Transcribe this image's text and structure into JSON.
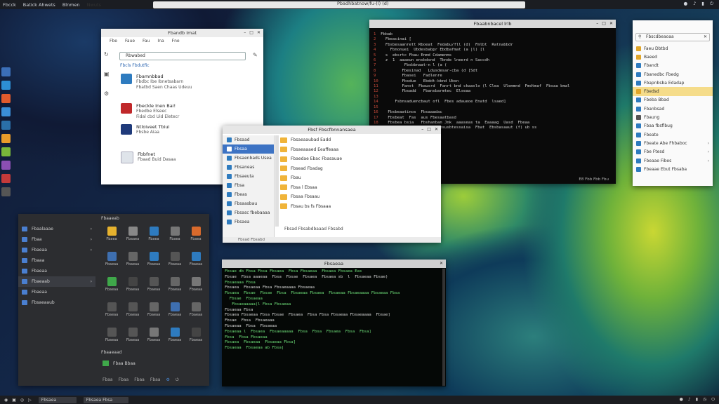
{
  "topbar": {
    "items": [
      "Fbcck",
      "Batick Ahwets",
      "Blnmen",
      "Nwuts"
    ],
    "center_title": "Pbadhbatnow/fu-(l) (d)",
    "right_icons": [
      "network-icon",
      "volume-icon",
      "battery-icon",
      "power-icon"
    ]
  },
  "software_window": {
    "title": "Fbandb Imat",
    "menu": [
      "Fbe",
      "Faue",
      "Fau",
      "Ina",
      "Fne"
    ],
    "search_value": "Rbwabed",
    "hint": "Fbcls Fbdutfic",
    "items": [
      {
        "title": "Fbamnbbad",
        "sub1": "Fbdbc Ibe Ibnetsabarn",
        "sub2": "Fbatbd Saen Chaas Udeuu",
        "color": "#2e7bbf"
      },
      {
        "title": "Fbeckle Inen Bai!",
        "sub1": "Fbedbe Elseec",
        "sub2": "Fidal cbd Uid Eletecr",
        "color": "#c0282a"
      },
      {
        "title": "Ntloiveet Tbiui",
        "sub1": "Fbsbe Aiaa",
        "sub2": "",
        "color": "#1f3a7a"
      },
      {
        "title": "Fbbfnet",
        "sub1": "Fbaad Buid Dasaa",
        "sub2": "",
        "color": "#dfe4ea"
      }
    ]
  },
  "code_window": {
    "title": "Fbaabnbacel lrlb",
    "lines": [
      {
        "n": "1",
        "t": "Fbbab"
      },
      {
        "n": "2",
        "t": "  Fbeacinai ["
      },
      {
        "n": "3",
        "t": "  Fbsbesaanrett Rboeat  Fedabu/fll (d)  Fmlbt  Ratnabbdr"
      },
      {
        "n": "4",
        "t": "    Fbnonuei  Ubdesbabpr Ebdbafmat (a |l) [l"
      },
      {
        "n": "5",
        "t": "  s  ebsrtc Fbau Enmd Cdamenms"
      },
      {
        "n": "6",
        "t": "  z  1  aaaeun ensbdsnd  Tbnde lneerd n Saccdh"
      },
      {
        "n": "7",
        "t": "          Fbsbbnaat-n l (a ("
      },
      {
        "n": "8",
        "t": "         Fbesinad   Ldusdesar-cba (d [Sdt"
      },
      {
        "n": "9",
        "t": "         Fbasei   Fadlenre"
      },
      {
        "n": "10",
        "t": "        Fbsdue   Ebddt-bbnd Ubsn"
      },
      {
        "n": "11",
        "t": "        Fanst  Fbausrd  Fanrt bnd ckaaslo (l Clea  Ulemmnd  Fmdtmaf  Fbsaa bmal"
      },
      {
        "n": "12",
        "t": "        Fbsadd   Fbansbarmtec  Elseaa"
      },
      {
        "n": "13",
        "t": ""
      },
      {
        "n": "14",
        "t": "     Fsbnsaduencbaut ofl  Fbes adaueoe Enatd  lsaed]"
      },
      {
        "n": "15",
        "t": ""
      },
      {
        "n": "16",
        "t": "  Fbsbeaatinos  Fbsaaadac"
      },
      {
        "n": "17",
        "t": "  Fbsbeat  Fas  aus Fbesaatbasd"
      },
      {
        "n": "18",
        "t": "  Fbsbea bsia   Fbshanban Jnk  aaaseas ta  Eaaaag  Uasd  Fbeaa"
      },
      {
        "n": "19",
        "t": "   Fbc  Ebsdat  Fasec  Fbsusbtessaisa  Fbat  Ebsbasaaut (f) ub ss"
      }
    ],
    "status": "E8   Fbb  Fbb  Fbu"
  },
  "list_panel": {
    "search_placeholder": "Fbscdbeaoaa",
    "items": [
      {
        "label": "Faeu  Dbtbd",
        "color": "#e0a62a",
        "arrow": false,
        "selected": false
      },
      {
        "label": "Baeed",
        "color": "#e0a62a",
        "arrow": false,
        "selected": false
      },
      {
        "label": "Fbandt",
        "color": "#2e7bbf",
        "arrow": false,
        "selected": false
      },
      {
        "label": "Fbanedbc Fbedg",
        "color": "#2e7bbf",
        "arrow": false,
        "selected": false
      },
      {
        "label": "Fbapnbsba Edadap",
        "color": "#2e7bbf",
        "arrow": false,
        "selected": false
      },
      {
        "label": "Fbedsd",
        "color": "#e0a62a",
        "arrow": false,
        "selected": true
      },
      {
        "label": "Fbeba Bbad",
        "color": "#2e7bbf",
        "arrow": false,
        "selected": false
      },
      {
        "label": "Fbanbsad",
        "color": "#2e7bbf",
        "arrow": false,
        "selected": false
      },
      {
        "label": "Fbaung",
        "color": "#555555",
        "arrow": false,
        "selected": false
      },
      {
        "label": "Fbaa fbsflbug",
        "color": "#2e7bbf",
        "arrow": false,
        "selected": false
      },
      {
        "label": "Fbeate",
        "color": "#2e7bbf",
        "arrow": false,
        "selected": false
      },
      {
        "label": "Fbeate Abe Fhbaboc",
        "color": "#2e7bbf",
        "arrow": true,
        "selected": false
      },
      {
        "label": "Fbe Ftesd",
        "color": "#2e7bbf",
        "arrow": true,
        "selected": false
      },
      {
        "label": "Fbeaae Fibes",
        "color": "#2e7bbf",
        "arrow": true,
        "selected": false
      },
      {
        "label": "Fbeaae Ebut Fbsaba",
        "color": "#2e7bbf",
        "arrow": false,
        "selected": false
      }
    ]
  },
  "files_window": {
    "title": "Fbsf Fbscfbnnansaea",
    "sidebar": [
      {
        "label": "Fbsaad",
        "color": "#2e7bbf",
        "selected": false
      },
      {
        "label": "Fbsaa",
        "color": "#2e7bbf",
        "selected": true
      },
      {
        "label": "Fbsaenbads Usea",
        "color": "#2e7bbf",
        "selected": false
      },
      {
        "label": "Fbsaneas",
        "color": "#2e7bbf",
        "selected": false
      },
      {
        "label": "Fbsaeuta",
        "color": "#2e7bbf",
        "selected": false
      },
      {
        "label": "Fbsa",
        "color": "#2e7bbf",
        "selected": false
      },
      {
        "label": "Fbeas",
        "color": "#2e7bbf",
        "selected": false
      },
      {
        "label": "Fbsaasbau",
        "color": "#2e7bbf",
        "selected": false
      },
      {
        "label": "Fbsasc fbebaaaa",
        "color": "#2e7bbf",
        "selected": false
      },
      {
        "label": "Fbsaea",
        "color": "#2e7bbf",
        "selected": false
      }
    ],
    "rows": [
      "Fbsaeaaubad Eadd",
      "Fbsaeaaaed Eeaffeaaa",
      "Fbaedae Ebac Fbasauae",
      "Fbsead Fbadag",
      "Fbau",
      "Fbsa l Ebsaa",
      "Fbsaa Fbsaau",
      "Fbsau bs fs Fbsaaa"
    ],
    "footer_text": "Fbsad Fbsabdbaaad Fbsabd",
    "status": "Fbsad Fbsabd"
  },
  "apps_window": {
    "header": "Fbaaeab",
    "sidebar": [
      {
        "label": "Fbaalaaae",
        "arrow": true,
        "selected": false
      },
      {
        "label": "Fbaa",
        "arrow": true,
        "selected": false
      },
      {
        "label": "Fbaeaa",
        "arrow": true,
        "selected": false
      },
      {
        "label": "Fbaaa",
        "arrow": false,
        "selected": false
      },
      {
        "label": "Fbaeaa",
        "arrow": false,
        "selected": false
      },
      {
        "label": "Fbaeaab",
        "arrow": true,
        "selected": true
      },
      {
        "label": "Fbaeaa",
        "arrow": false,
        "selected": false
      },
      {
        "label": "Fbsaeaaub",
        "arrow": false,
        "selected": false
      }
    ],
    "grid": [
      {
        "label": "Fbaea",
        "color": "#e6b22e"
      },
      {
        "label": "Fbaaea",
        "color": "#888888"
      },
      {
        "label": "Fbaea",
        "color": "#2e7bbf"
      },
      {
        "label": "Fbaea",
        "color": "#777777"
      },
      {
        "label": "Fbaea",
        "color": "#d96a2c"
      },
      {
        "label": "Fbaeaa",
        "color": "#3e6fb0"
      },
      {
        "label": "Fbaeaa",
        "color": "#666666"
      },
      {
        "label": "Fbaeaa",
        "color": "#2e7bbf"
      },
      {
        "label": "Fbaeaa",
        "color": "#555555"
      },
      {
        "label": "Fbaeaa",
        "color": "#2e7bbf"
      },
      {
        "label": "Fbaeaa",
        "color": "#3fa84a"
      },
      {
        "label": "Fbaeaa",
        "color": "#444444"
      },
      {
        "label": "Fbaeaa",
        "color": "#555555"
      },
      {
        "label": "Fbaeaa",
        "color": "#666666"
      },
      {
        "label": "Fbaeaa",
        "color": "#777777"
      },
      {
        "label": "Fbaeaa",
        "color": "#555555"
      },
      {
        "label": "Fbaeaa",
        "color": "#555555"
      },
      {
        "label": "Fbaeaa",
        "color": "#666666"
      },
      {
        "label": "Fbaeaa",
        "color": "#3e6fb0"
      },
      {
        "label": "Fbaeaa",
        "color": "#666666"
      },
      {
        "label": "Fbaeaa",
        "color": "#555555"
      },
      {
        "label": "Fbaeaa",
        "color": "#555555"
      },
      {
        "label": "Fbaeaa",
        "color": "#777777"
      },
      {
        "label": "Fbaeaa",
        "color": "#2e7bbf"
      },
      {
        "label": "Fbaeaa",
        "color": "#444444"
      }
    ],
    "favorites_label": "Fbaaeaad",
    "favorite_item": "Fbaa Bbaa",
    "bottom": [
      "Fbaa",
      "Fbaa",
      "Fbaa",
      "Fbaa"
    ]
  },
  "terminal_window": {
    "title": "Fbsaeaa",
    "lines": [
      {
        "t": "Fbsae db Fbsa Fbsa Fbsaea  Fbsa Fbsaeaa  Fbsaea Fbsaea Eas",
        "c": "g"
      },
      {
        "t": "Fbsae  Fbsa aaaeaa  Fbsa  Fbsae  Fbsaea  Fbsaea sb  l  Fbsaeaa Fbsae)",
        "c": "w"
      },
      {
        "t": "Fbsaeaaa Fbsa",
        "c": "g"
      },
      {
        "t": "Fbsaea  Fbsaeaa Fbsa Fbsaeaaaa Fbsaeaa",
        "c": "w"
      },
      {
        "t": "Fbsaea  Fbsae  Fbsae  Fbsa  Fbsaeaa Fbsaea  Fbsaeaa Fbsaeaaaa Fbsaeaa Fbsa",
        "c": "g"
      },
      {
        "t": "  Fbsae  Fbsaeaa",
        "c": "g"
      },
      {
        "t": "   Fbsaeaaaaa(l Fbsa Fbsaeaa",
        "c": "g"
      },
      {
        "t": "Fbsaeaa Fbsa",
        "c": "w"
      },
      {
        "t": "Fbsaea Fbsaeaa Fbsa Fbsae  Fbsaea  Fbsa Fbsa Fbsaeaa Fbsaeaaaa  Fbsae]",
        "c": "w"
      },
      {
        "t": "Fbsae  Fbsa  Fbsaeaaa",
        "c": "w"
      },
      {
        "t": "Fbsaeaa  Fbsa  Fbsaeaa",
        "c": "w"
      },
      {
        "t": "Fbsaeaa l  Fbsaea  Fbsaeaaaaa  Fbsa  Fbsa  Fbsaea  Fbsa  Fbsa]",
        "c": "g"
      },
      {
        "t": "Fbsa  Fbsa Fbsaeaa",
        "c": "g"
      },
      {
        "t": "Fbsaea  Fbsaeaa  Fbsaeaa Fbsa]",
        "c": "g"
      },
      {
        "t": "Fbsaeaa  Fbsaeaa ab Fbsa|",
        "c": "g"
      }
    ]
  },
  "taskbar": {
    "tasks": [
      "Fbsaea",
      "Fbsaea Fbsa"
    ],
    "right_icons": [
      "network-icon",
      "volume-icon",
      "battery-icon",
      "clock-icon",
      "power-icon"
    ]
  }
}
